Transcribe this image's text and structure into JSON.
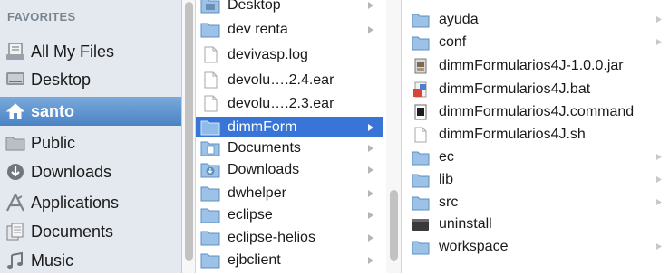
{
  "sidebar": {
    "header": "FAVORITES",
    "items": [
      {
        "label": "All My Files",
        "icon": "all-files-icon"
      },
      {
        "label": "Desktop",
        "icon": "desktop-icon"
      },
      {
        "label": "santo",
        "icon": "home-icon",
        "selected": true
      },
      {
        "label": "Public",
        "icon": "folder-icon"
      },
      {
        "label": "Downloads",
        "icon": "downloads-icon"
      },
      {
        "label": "Applications",
        "icon": "applications-icon"
      },
      {
        "label": "Documents",
        "icon": "documents-icon"
      },
      {
        "label": "Music",
        "icon": "music-icon"
      }
    ]
  },
  "column2": {
    "items": [
      {
        "label": "Desktop",
        "type": "folder",
        "has_children": true
      },
      {
        "label": "dev renta",
        "type": "folder",
        "has_children": true
      },
      {
        "label": "devivasp.log",
        "type": "file",
        "has_children": false
      },
      {
        "label": "devolu….2.4.ear",
        "type": "file",
        "has_children": false
      },
      {
        "label": "devolu….2.3.ear",
        "type": "file",
        "has_children": false
      },
      {
        "label": "dimmForm",
        "type": "folder",
        "has_children": true,
        "selected": true
      },
      {
        "label": "Documents",
        "type": "folder-docs",
        "has_children": true
      },
      {
        "label": "Downloads",
        "type": "folder-downloads",
        "has_children": true
      },
      {
        "label": "dwhelper",
        "type": "folder",
        "has_children": true
      },
      {
        "label": "eclipse",
        "type": "folder",
        "has_children": true
      },
      {
        "label": "eclipse-helios",
        "type": "folder",
        "has_children": true
      },
      {
        "label": "ejbclient",
        "type": "folder",
        "has_children": true
      }
    ]
  },
  "column3": {
    "items": [
      {
        "label": "ayuda",
        "type": "folder",
        "has_children": true
      },
      {
        "label": "conf",
        "type": "folder",
        "has_children": true
      },
      {
        "label": "dimmFormularios4J-1.0.0.jar",
        "type": "jar",
        "has_children": false
      },
      {
        "label": "dimmFormularios4J.bat",
        "type": "bat",
        "has_children": false
      },
      {
        "label": "dimmFormularios4J.command",
        "type": "command",
        "has_children": false
      },
      {
        "label": "dimmFormularios4J.sh",
        "type": "file",
        "has_children": false
      },
      {
        "label": "ec",
        "type": "folder",
        "has_children": true
      },
      {
        "label": "lib",
        "type": "folder",
        "has_children": true
      },
      {
        "label": "src",
        "type": "folder",
        "has_children": true
      },
      {
        "label": "uninstall",
        "type": "exec",
        "has_children": false
      },
      {
        "label": "workspace",
        "type": "folder",
        "has_children": true
      }
    ]
  },
  "colors": {
    "sidebar_bg": "#e4e9ef",
    "selection_blue": "#3875d7",
    "folder_blue": "#9cc2e8",
    "header_gray": "#7b8590"
  }
}
